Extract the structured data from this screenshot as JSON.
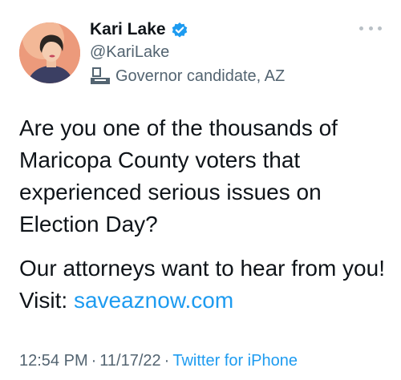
{
  "author": {
    "display_name": "Kari Lake",
    "handle": "@KariLake",
    "label": "Governor candidate, AZ",
    "verified_color": "#1d9bf0",
    "avatar_icon": "profile-photo",
    "label_icon": "government-building-icon"
  },
  "tweet": {
    "paragraph_1": "Are you one of the thousands of Maricopa County voters that experienced serious issues on Election Day?",
    "paragraph_2_prefix": "Our attorneys want to hear from you! Visit: ",
    "link_text": "saveaznow.com"
  },
  "meta": {
    "time": "12:54 PM",
    "date": "11/17/22",
    "dot_1": "·",
    "dot_2": "·",
    "source": "Twitter for iPhone"
  },
  "colors": {
    "text": "#0f1419",
    "secondary": "#536471",
    "accent": "#1d9bf0"
  }
}
